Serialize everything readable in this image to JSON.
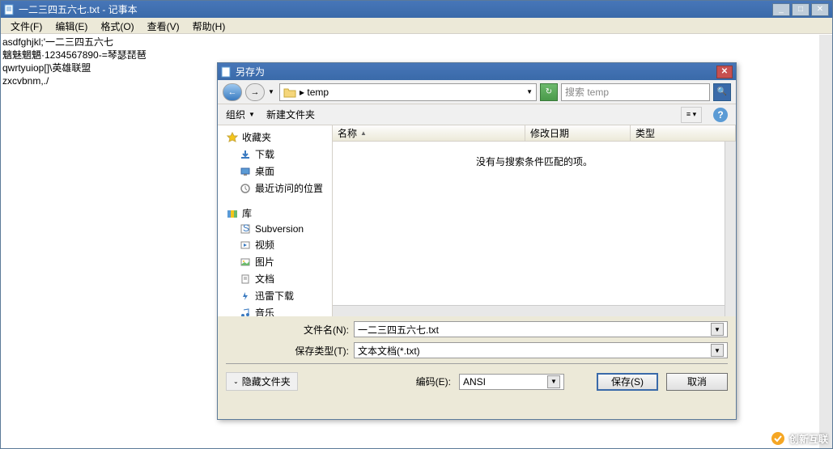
{
  "notepad": {
    "title": "一二三四五六七.txt - 记事本",
    "menu": [
      "文件(F)",
      "编辑(E)",
      "格式(O)",
      "查看(V)",
      "帮助(H)"
    ],
    "content": [
      "asdfghjkl;'一二三四五六七",
      "魑魅魍魉·1234567890-=琴瑟琵琶",
      "qwrtyuiop[]\\英雄联盟",
      "zxcvbnm,./"
    ]
  },
  "dialog": {
    "title": "另存为",
    "path_prefix": "▸ temp",
    "search_placeholder": "搜索 temp",
    "toolbar": {
      "organize": "组织",
      "new_folder": "新建文件夹"
    },
    "tree": {
      "favorites": "收藏夹",
      "downloads": "下载",
      "desktop": "桌面",
      "recent": "最近访问的位置",
      "libraries": "库",
      "subversion": "Subversion",
      "videos": "视频",
      "pictures": "图片",
      "documents": "文档",
      "xunlei": "迅雷下载",
      "music": "音乐"
    },
    "list": {
      "col_name": "名称",
      "col_date": "修改日期",
      "col_type": "类型",
      "empty_msg": "没有与搜索条件匹配的项。"
    },
    "fields": {
      "filename_label": "文件名(N):",
      "filename_value": "一二三四五六七.txt",
      "filetype_label": "保存类型(T):",
      "filetype_value": "文本文档(*.txt)"
    },
    "footer": {
      "hide_folders": "隐藏文件夹",
      "encoding_label": "编码(E):",
      "encoding_value": "ANSI",
      "save": "保存(S)",
      "cancel": "取消"
    }
  },
  "watermark": "创新互联"
}
